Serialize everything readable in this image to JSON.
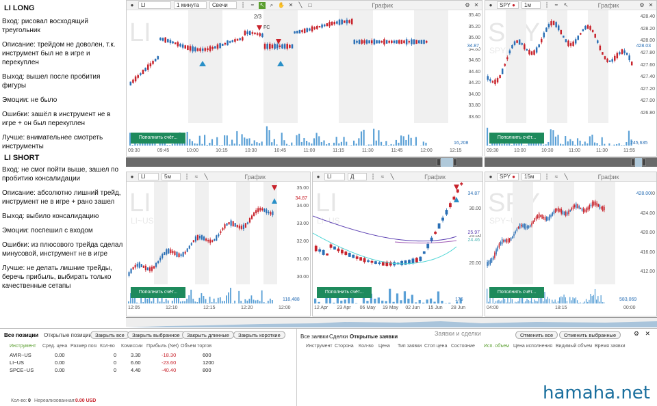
{
  "notes": {
    "long_title": "LI LONG",
    "long": [
      "Вход: рисовал восходящий треугольник",
      "Описание: трейдом не доволен, т.к. инструмент был не в игре и перекуплен",
      "Выход: вышел после пробития фигуры",
      "Эмоции: не было",
      "Ошибки: зашёл в инструмент не в игре + он был перекуплен",
      "Лучше: внимательнее смотреть инструменты"
    ],
    "short_title": "LI SHORT",
    "short": [
      "Вход: не смог пойти выше, зашел по пробитию консалидации",
      "Описание: абсолютно лишний трейд, инструмент не в игре + рано зашел",
      "Выход: выбило консалидацию",
      "Эмоции: поспешил с входом",
      "Ошибки: из плюсового трейда сделал минусовой, инструмент не в игре",
      "Лучше: не делать лишние трейды, беречь прибыль, выбирать только качественные сетапы"
    ]
  },
  "charts": {
    "c1": {
      "symbol": "LI",
      "interval": "1 минута",
      "type": "Свечи",
      "title": "График",
      "wm": "LI",
      "price": "34.87",
      "vol": "16,208",
      "fc": "FC",
      "ratio": "2/3",
      "y": [
        "35.40",
        "35.20",
        "35.00",
        "34.80",
        "34.60",
        "34.40",
        "34.20",
        "34.00",
        "33.80",
        "33.60"
      ],
      "x": [
        "09:30",
        "09:45",
        "10:00",
        "10:15",
        "10:30",
        "10:45",
        "11:00",
        "11:15",
        "11:30",
        "11:45",
        "12:00",
        "12:15"
      ],
      "btn": "Пополнить счёт..."
    },
    "c2": {
      "symbol": "SPY",
      "interval": "1м",
      "title": "График",
      "wm": "SPY",
      "wm2": "SPY~US",
      "price": "428.03",
      "vol": "245,635",
      "y": [
        "428.40",
        "428.20",
        "428.00",
        "427.80",
        "427.60",
        "427.40",
        "427.20",
        "427.00",
        "426.80"
      ],
      "x": [
        "09:30",
        "10:00",
        "10:30",
        "11:00",
        "11:30",
        "11:55"
      ],
      "btn": "Пополнить счёт..."
    },
    "c3": {
      "symbol": "LI",
      "interval": "5м",
      "title": "График",
      "wm": "LI",
      "wm2": "LI~US",
      "price": "34.87",
      "vol": "118,488",
      "y": [
        "35.00",
        "34.00",
        "33.00",
        "32.00",
        "31.00",
        "30.00"
      ],
      "x": [
        "12:05",
        "12:10",
        "12:15",
        "12:20",
        "12:00"
      ],
      "btn": "Пополнить счёт..."
    },
    "c4": {
      "symbol": "LI",
      "interval": "Д",
      "title": "График",
      "wm": "LI",
      "wm2": "LI~US",
      "price": "34.87",
      "ma1": "25.97",
      "ma2": "24.46",
      "vol": "176",
      "y": [
        "30.00",
        "25.00",
        "20.00"
      ],
      "x": [
        "12 Apr",
        "23 Apr",
        "06 May",
        "19 May",
        "02 Jun",
        "15 Jun",
        "28 Jun"
      ],
      "btn": "Пополнить счёт..."
    },
    "c5": {
      "symbol": "SPY",
      "interval": "15м",
      "title": "График",
      "wm": "SPY",
      "wm2": "SPY~US",
      "price": "428.00",
      "vol": "583,069",
      "y": [
        "428.00",
        "424.00",
        "420.00",
        "416.00",
        "412.00"
      ],
      "x": [
        "04:00",
        "18:15",
        "00:00"
      ],
      "btn": "Пополнить счёт..."
    }
  },
  "positions": {
    "tab_all": "Все позиции",
    "tab_open": "Открытые позиции",
    "btns": [
      "Закрыть все",
      "Закрыть выбранное",
      "Закрыть длинные",
      "Закрыть короткие"
    ],
    "headers": [
      "Инструмент",
      "Сред. цена",
      "Размер позиции",
      "Кол-во",
      "Комиссии",
      "Прибыль (Net)",
      "Объем торгов"
    ],
    "rows": [
      {
        "sym": "AVIR~US",
        "avg": "0.00",
        "qty": "0",
        "fee": "3.30",
        "pnl": "-18.30",
        "vol": "600"
      },
      {
        "sym": "LI~US",
        "avg": "0.00",
        "qty": "0",
        "fee": "6.60",
        "pnl": "-23.60",
        "vol": "1200"
      },
      {
        "sym": "SPCE~US",
        "avg": "0.00",
        "qty": "0",
        "fee": "4.40",
        "pnl": "-40.40",
        "vol": "800"
      }
    ],
    "footer_qty_label": "Кол-во:",
    "footer_qty": "0",
    "footer_unreal_label": "Нереализованная:",
    "footer_unreal": "0.00 USD"
  },
  "orders": {
    "title": "Заявки и сделки",
    "tabs": [
      "Все заявки",
      "Сделки",
      "Открытые заявки"
    ],
    "btns": [
      "Отменить все",
      "Отменить выбранные"
    ],
    "headers": [
      "Инструмент",
      "Сторона",
      "Кол-во",
      "Цена",
      "Тип заявки",
      "Стоп цена",
      "Состояние",
      "Исп. объем",
      "Цена исполнения",
      "Видимый объем",
      "Время заявки"
    ]
  },
  "watermark": "hamaha.net",
  "colors": {
    "up": "#2a6fb5",
    "down": "#c8232c",
    "accent": "#1e8a5c"
  }
}
